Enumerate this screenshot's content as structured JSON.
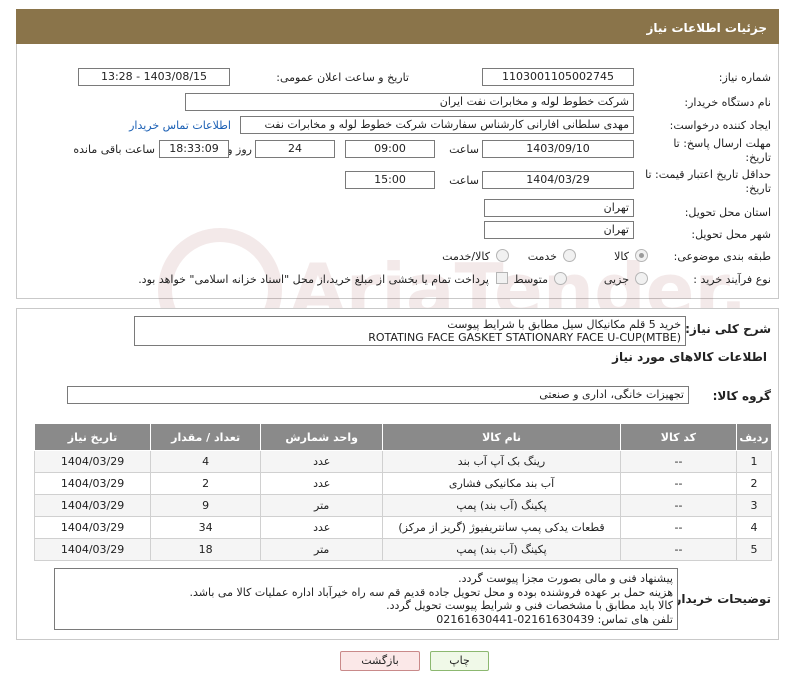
{
  "header": {
    "title": "جزئیات اطلاعات نیاز"
  },
  "fields": {
    "need_number_label": "شماره نیاز:",
    "need_number": "1103001105002745",
    "announce_label": "تاریخ و ساعت اعلان عمومی:",
    "announce_value": "1403/08/15 - 13:28",
    "buyer_org_label": "نام دستگاه خریدار:",
    "buyer_org": "شرکت خطوط لوله و مخابرات نفت ایران",
    "creator_label": "ایجاد کننده درخواست:",
    "creator": "مهدی سلطانی افارانی کارشناس سفارشات  شرکت خطوط لوله و مخابرات نفت",
    "contact_link": "اطلاعات تماس خریدار",
    "reply_label_1": "مهلت ارسال پاسخ: تا",
    "reply_label_2": "تاریخ:",
    "reply_date": "1403/09/10",
    "time_label": "ساعت",
    "reply_time": "09:00",
    "days_value": "24",
    "days_label": "روز و",
    "remain_value": "18:33:09",
    "remain_label": "ساعت باقی مانده",
    "validity_label_1": "حداقل تاریخ اعتبار قیمت: تا",
    "validity_label_2": "تاریخ:",
    "validity_date": "1404/03/29",
    "validity_time": "15:00",
    "province_label": "استان محل تحویل:",
    "province": "تهران",
    "city_label": "شهر محل تحویل:",
    "city": "تهران",
    "category_label": "طبقه بندی موضوعی:",
    "cat_goods": "کالا",
    "cat_service": "خدمت",
    "cat_both": "کالا/خدمت",
    "purchase_label": "نوع فرآیند خرید :",
    "proc_partial": "جزیی",
    "proc_medium": "متوسط",
    "payment_note": "پرداخت تمام یا بخشی از مبلغ خرید،از محل \"اسناد خزانه اسلامی\" خواهد بود."
  },
  "description": {
    "label": "شرح کلی نیاز:",
    "line1": "خرید 5 قلم مکانیکال سیل مطابق با شرایط پیوست",
    "line2": "ROTATING FACE        GASKET  STATIONARY FACE     U-CUP(MTBE)"
  },
  "goods": {
    "title": "اطلاعات کالاهای مورد نیاز",
    "group_label": "گروه کالا:",
    "group_value": "تجهیزات خانگی، اداری و صنعتی",
    "columns": [
      "ردیف",
      "کد کالا",
      "نام کالا",
      "واحد شمارش",
      "تعداد / مقدار",
      "تاریخ نیاز"
    ],
    "rows": [
      [
        "1",
        "--",
        "رینگ بک آپ آب بند",
        "عدد",
        "4",
        "1404/03/29"
      ],
      [
        "2",
        "--",
        "آب بند مکانیکی فشاری",
        "عدد",
        "2",
        "1404/03/29"
      ],
      [
        "3",
        "--",
        "پکینگ (آب بند) پمپ",
        "متر",
        "9",
        "1404/03/29"
      ],
      [
        "4",
        "--",
        "قطعات یدکی پمپ سانتریفیوژ (گریز از مرکز)",
        "عدد",
        "34",
        "1404/03/29"
      ],
      [
        "5",
        "--",
        "پکینگ (آب بند) پمپ",
        "متر",
        "18",
        "1404/03/29"
      ]
    ]
  },
  "notes": {
    "label": "توضیحات خریدار:",
    "line1": "پیشنهاد فنی و مالی بصورت مجزا پیوست گردد.",
    "line2": "هزینه حمل بر عهده فروشنده بوده و محل تحویل جاده قدیم قم سه راه خیرآباد اداره عملیات کالا می باشد.",
    "line3": "کالا باید  مطابق با مشخصات فنی و شرایط پیوست تحویل گردد.",
    "line4": "تلفن های تماس: 02161630439-02161630441"
  },
  "buttons": {
    "print": "چاپ",
    "back": "بازگشت"
  },
  "watermark": "AriaTender.neT"
}
